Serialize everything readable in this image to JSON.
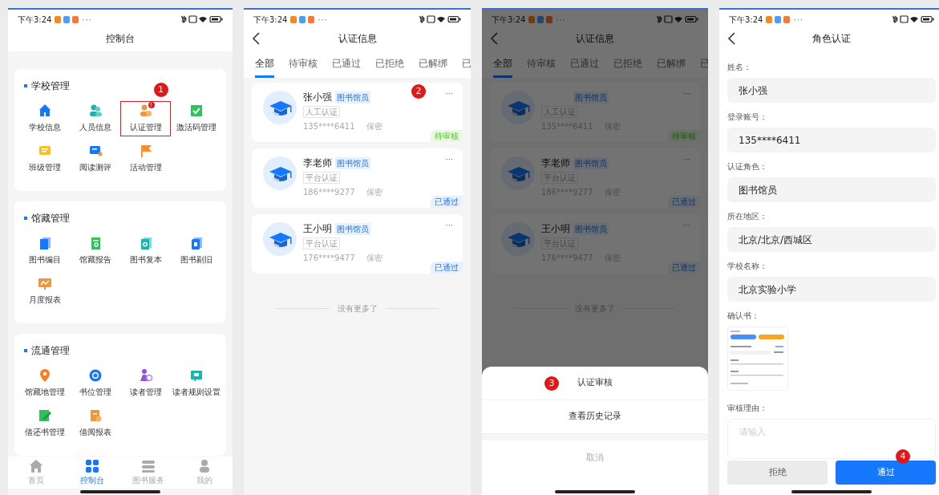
{
  "screens": [
    {
      "kind": "dashboard",
      "status_bar": {
        "time": "下午3:24",
        "more": "···"
      },
      "title": "控制台",
      "sections": [
        {
          "title": "学校管理",
          "items": [
            {
              "label": "学校信息",
              "highlighted": false
            },
            {
              "label": "人员信息",
              "highlighted": false
            },
            {
              "label": "认证管理",
              "badge": "!",
              "highlighted": true,
              "step": "1"
            },
            {
              "label": "激活码管理",
              "highlighted": false
            },
            {
              "label": "班级管理",
              "highlighted": false
            },
            {
              "label": "阅读测评",
              "highlighted": false
            },
            {
              "label": "活动管理",
              "highlighted": false
            }
          ]
        },
        {
          "title": "馆藏管理",
          "items": [
            {
              "label": "图书编目",
              "highlighted": false
            },
            {
              "label": "馆藏报告",
              "highlighted": false
            },
            {
              "label": "图书复本",
              "highlighted": false
            },
            {
              "label": "图书剔旧",
              "highlighted": false
            },
            {
              "label": "月度报表",
              "highlighted": false
            }
          ]
        },
        {
          "title": "流通管理",
          "items": [
            {
              "label": "馆藏地管理",
              "highlighted": false
            },
            {
              "label": "书位管理",
              "highlighted": false
            },
            {
              "label": "读者管理",
              "highlighted": false
            },
            {
              "label": "读者规则设置",
              "highlighted": false
            },
            {
              "label": "借还书管理",
              "highlighted": false
            },
            {
              "label": "借阅报表",
              "highlighted": false
            }
          ]
        }
      ],
      "tab_bar": [
        {
          "label": "首页",
          "selected": false
        },
        {
          "label": "控制台",
          "selected": true
        },
        {
          "label": "图书服务",
          "selected": false
        },
        {
          "label": "我的",
          "selected": false
        }
      ]
    },
    {
      "kind": "cert_list",
      "status_bar": {
        "time": "下午3:24",
        "more": "···"
      },
      "title": "认证信息",
      "tabs": [
        {
          "label": "全部",
          "selected": true
        },
        {
          "label": "待审核",
          "selected": false
        },
        {
          "label": "已通过",
          "selected": false
        },
        {
          "label": "已拒绝",
          "selected": false
        },
        {
          "label": "已解绑",
          "selected": false
        },
        {
          "label": "已",
          "selected": false
        }
      ],
      "cards": [
        {
          "name": "张小强",
          "role": "图书馆员",
          "method": "人工认证",
          "phone": "135****6411",
          "privacy": "保密",
          "more": "···",
          "status": "待审核",
          "kind": "pending",
          "step": "2"
        },
        {
          "name": "李老师",
          "role": "图书馆员",
          "method": "平台认证",
          "phone": "186****9277",
          "privacy": "保密",
          "more": "···",
          "status": "已通过",
          "kind": "approved"
        },
        {
          "name": "王小明",
          "role": "图书馆员",
          "method": "平台认证",
          "phone": "176****9477",
          "privacy": "保密",
          "more": "···",
          "status": "已通过",
          "kind": "approved"
        }
      ],
      "footer": "没有更多了"
    },
    {
      "kind": "cert_list",
      "status_bar": {
        "time": "下午3:24",
        "more": "···"
      },
      "title": "认证信息",
      "dimmed": true,
      "tabs": [
        {
          "label": "全部",
          "selected": true
        },
        {
          "label": "待审核",
          "selected": false
        },
        {
          "label": "已通过",
          "selected": false
        },
        {
          "label": "已拒绝",
          "selected": false
        },
        {
          "label": "已解绑",
          "selected": false
        },
        {
          "label": "已",
          "selected": false
        }
      ],
      "cards": [
        {
          "role": "图书馆员",
          "method": "人工认证",
          "phone": "135****6411",
          "privacy": "保密",
          "more": "···",
          "status": "待审核",
          "kind": "pending"
        },
        {
          "name": "李老师",
          "role": "图书馆员",
          "method": "平台认证",
          "phone": "186****9277",
          "privacy": "保密",
          "more": "···",
          "status": "已通过",
          "kind": "approved"
        },
        {
          "name": "王小明",
          "role": "图书馆员",
          "method": "平台认证",
          "phone": "176****9477",
          "privacy": "保密",
          "more": "···",
          "status": "已通过",
          "kind": "approved"
        }
      ],
      "footer": "没有更多了",
      "action_sheet": {
        "actions": [
          {
            "label": "认证审核",
            "step": "3"
          },
          {
            "label": "查看历史记录"
          }
        ],
        "cancel": "取消"
      }
    },
    {
      "kind": "role_form",
      "status_bar": {
        "time": "下午3:24",
        "more": "···"
      },
      "title": "角色认证",
      "fields": [
        {
          "label": "姓名：",
          "value": "张小强"
        },
        {
          "label": "登录账号：",
          "value": "135****6411"
        },
        {
          "label": "认证角色：",
          "value": "图书馆员"
        },
        {
          "label": "所在地区：",
          "value": "北京/北京/西城区"
        },
        {
          "label": "学校名称：",
          "value": "北京实验小学"
        }
      ],
      "attachment_label": "确认书：",
      "reason": {
        "label": "审核理由：",
        "placeholder": "请输入"
      },
      "step": "4",
      "buttons": [
        {
          "label": "拒绝",
          "kind": "reject"
        },
        {
          "label": "通过",
          "kind": "approve"
        }
      ]
    }
  ]
}
